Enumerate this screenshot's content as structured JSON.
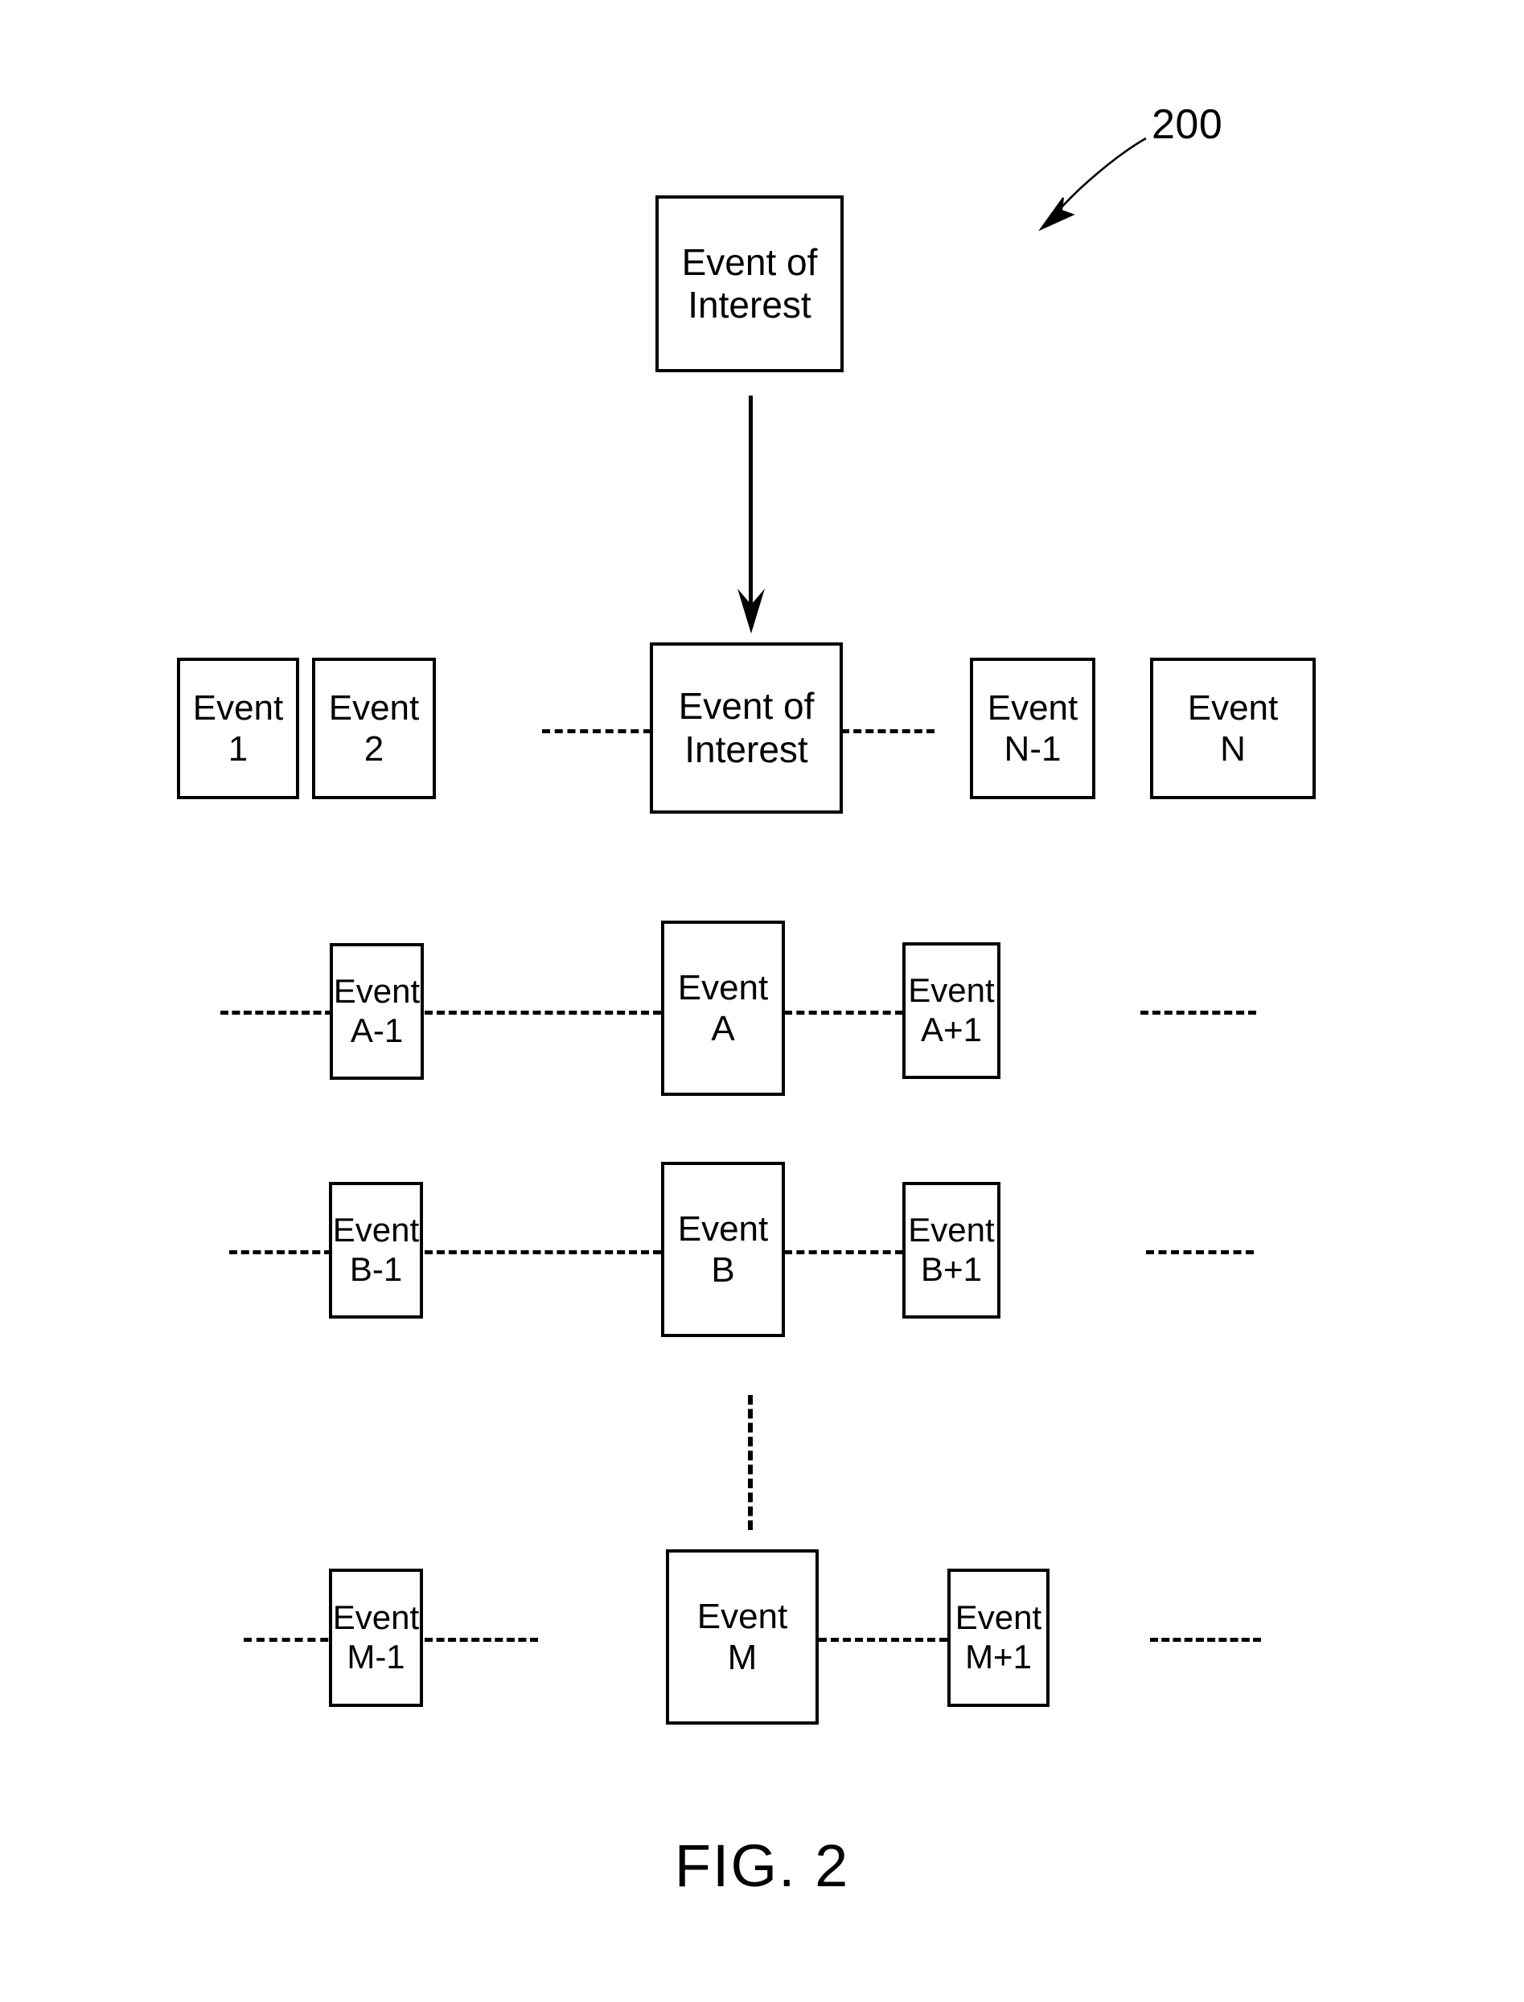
{
  "figure": {
    "caption": "FIG. 2",
    "reference_numeral": "200"
  },
  "top_event": {
    "line1": "Event of",
    "line2": "Interest"
  },
  "sequence_row": {
    "boxes": [
      {
        "line1": "Event",
        "line2": "1"
      },
      {
        "line1": "Event",
        "line2": "2"
      },
      {
        "line1": "Event of",
        "line2": "Interest"
      },
      {
        "line1": "Event",
        "line2": "N-1"
      },
      {
        "line1": "Event",
        "line2": "N"
      }
    ]
  },
  "occurrence_rows": [
    {
      "id": "row-a",
      "boxes": [
        {
          "line1": "Event",
          "line2": "A-1"
        },
        {
          "line1": "Event",
          "line2": "A"
        },
        {
          "line1": "Event",
          "line2": "A+1"
        }
      ]
    },
    {
      "id": "row-b",
      "boxes": [
        {
          "line1": "Event",
          "line2": "B-1"
        },
        {
          "line1": "Event",
          "line2": "B"
        },
        {
          "line1": "Event",
          "line2": "B+1"
        }
      ]
    },
    {
      "id": "row-m",
      "boxes": [
        {
          "line1": "Event",
          "line2": "M-1"
        },
        {
          "line1": "Event",
          "line2": "M"
        },
        {
          "line1": "Event",
          "line2": "M+1"
        }
      ]
    }
  ],
  "colors": {
    "stroke": "#000000",
    "background": "#ffffff"
  }
}
